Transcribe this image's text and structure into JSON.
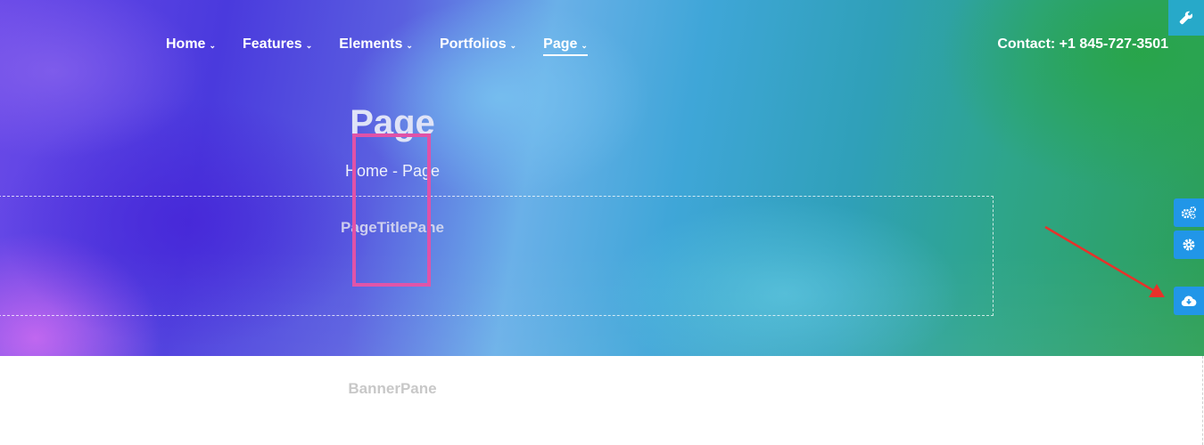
{
  "nav": {
    "items": [
      {
        "label": "Home",
        "chevron": "⌄"
      },
      {
        "label": "Features",
        "chevron": "⌄"
      },
      {
        "label": "Elements",
        "chevron": "⌄"
      },
      {
        "label": "Portfolios",
        "chevron": "⌄"
      },
      {
        "label": "Page",
        "chevron": "⌄",
        "active": true
      }
    ]
  },
  "contact": {
    "text": "Contact: +1 845-727-3501"
  },
  "page_title": {
    "title": "Page",
    "breadcrumb": "Home - Page",
    "pane_label": "PageTitlePane"
  },
  "banner": {
    "pane_label": "BannerPane"
  },
  "side_tools": {
    "wrench": {
      "icon": "wrench-icon"
    },
    "buttons": [
      {
        "icon": "cogs-icon"
      },
      {
        "icon": "gear-icon"
      },
      {
        "icon": "cloud-download-icon"
      }
    ]
  },
  "colors": {
    "accent_blue": "#2196e8",
    "tool_tab": "#27a9c9",
    "highlight": "#e052a8",
    "arrow": "#e8312a"
  }
}
